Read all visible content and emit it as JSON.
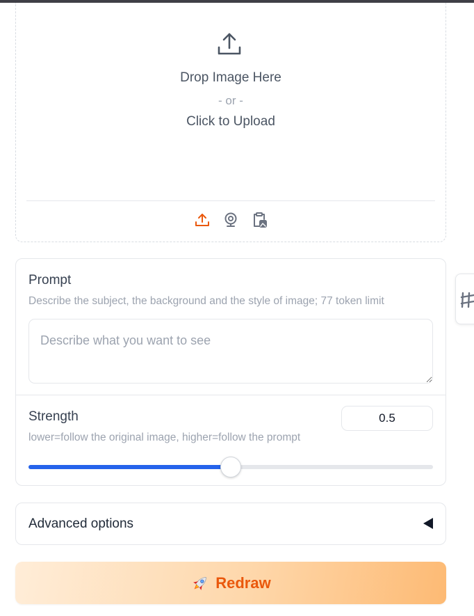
{
  "upload": {
    "drop_text": "Drop Image Here",
    "or_text": "- or -",
    "click_text": "Click to Upload",
    "sources": [
      "upload-icon",
      "webcam-icon",
      "clipboard-icon"
    ]
  },
  "prompt": {
    "label": "Prompt",
    "info": "Describe the subject, the background and the style of image; 77 token limit",
    "placeholder": "Describe what you want to see",
    "value": ""
  },
  "strength": {
    "label": "Strength",
    "info": "lower=follow the original image, higher=follow the prompt",
    "value": "0.5",
    "min": 0,
    "max": 1,
    "fraction": 0.5
  },
  "advanced": {
    "label": "Advanced options",
    "collapsed": true
  },
  "redraw": {
    "icon": "rocket-icon",
    "label": "Redraw"
  },
  "colors": {
    "accent": "#2563eb",
    "button_text": "#ea580c",
    "upload_active": "#ea580c"
  }
}
